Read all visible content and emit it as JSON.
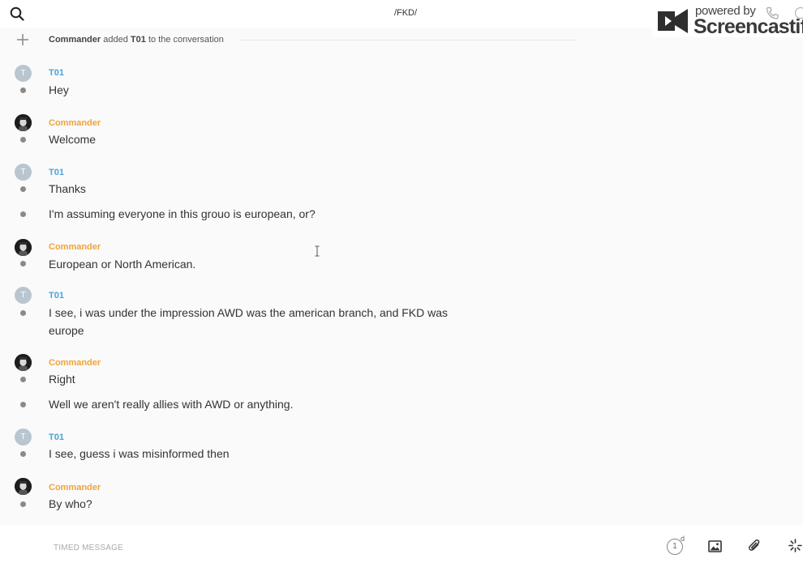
{
  "header": {
    "channel_title": "/FKD/"
  },
  "watermark": {
    "powered_by": "powered by",
    "brand": "Screencastify"
  },
  "system_message": {
    "actor": "Commander",
    "action": "added",
    "target": "T01",
    "suffix": "to the conversation"
  },
  "messages": [
    {
      "author": "T01",
      "avatar_letter": "T",
      "text": "Hey"
    },
    {
      "author": "Commander",
      "text": "Welcome"
    },
    {
      "author": "T01",
      "avatar_letter": "T",
      "text": "Thanks"
    },
    {
      "author": "T01",
      "text": "I'm assuming everyone in this grouo is european, or?"
    },
    {
      "author": "Commander",
      "text": "European or North American."
    },
    {
      "author": "T01",
      "avatar_letter": "T",
      "text": "I see, i was under the impression AWD was the american branch, and FKD was europe"
    },
    {
      "author": "Commander",
      "text": "Right"
    },
    {
      "author": "Commander",
      "text": "Well we aren't really allies with AWD or anything."
    },
    {
      "author": "T01",
      "avatar_letter": "T",
      "text": "I see, guess i was misinformed then"
    },
    {
      "author": "Commander",
      "text": "By who?"
    }
  ],
  "composer": {
    "placeholder": "TIMED MESSAGE",
    "timer_value": "1",
    "timer_unit": "d"
  },
  "colors": {
    "t01_name": "#4aa3df",
    "commander_name": "#f0a43a",
    "background": "#fafafa"
  }
}
